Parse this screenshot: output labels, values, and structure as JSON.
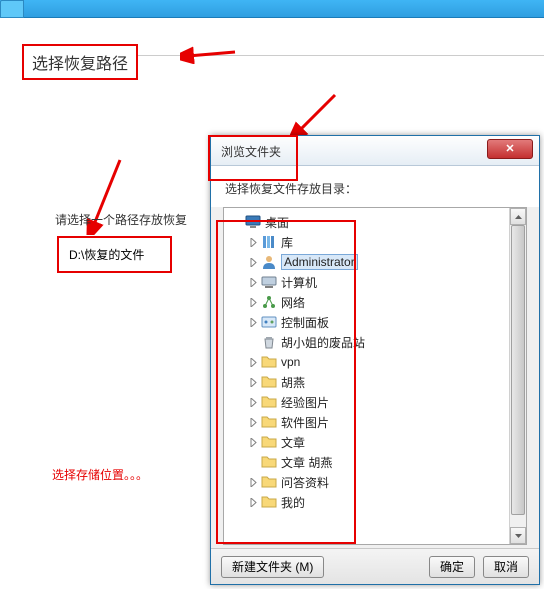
{
  "section_title": "选择恢复路径",
  "label_text": "请选择一个路径存放恢复",
  "path_value": "D:\\恢复的文件",
  "choose_text": "选择存储位置。。。",
  "dialog": {
    "title": "浏览文件夹",
    "close": "✕",
    "subtitle": "选择恢复文件存放目录：",
    "footer": {
      "new_folder": "新建文件夹 (M)",
      "ok": "确定",
      "cancel": "取消"
    }
  },
  "tree": [
    {
      "icon": "desktop",
      "label": "桌面",
      "depth": 0,
      "expand": "none"
    },
    {
      "icon": "library",
      "label": "库",
      "depth": 1,
      "expand": "closed"
    },
    {
      "icon": "user",
      "label": "Administrator",
      "depth": 1,
      "expand": "closed",
      "selected": true
    },
    {
      "icon": "computer",
      "label": "计算机",
      "depth": 1,
      "expand": "closed"
    },
    {
      "icon": "network",
      "label": "网络",
      "depth": 1,
      "expand": "closed"
    },
    {
      "icon": "control",
      "label": "控制面板",
      "depth": 1,
      "expand": "closed"
    },
    {
      "icon": "recycle",
      "label": "胡小姐的废品站",
      "depth": 1,
      "expand": "none"
    },
    {
      "icon": "folder",
      "label": "vpn",
      "depth": 1,
      "expand": "closed"
    },
    {
      "icon": "folder",
      "label": "胡燕",
      "depth": 1,
      "expand": "closed"
    },
    {
      "icon": "folder",
      "label": "经验图片",
      "depth": 1,
      "expand": "closed"
    },
    {
      "icon": "folder",
      "label": "软件图片",
      "depth": 1,
      "expand": "closed"
    },
    {
      "icon": "folder",
      "label": "文章",
      "depth": 1,
      "expand": "closed"
    },
    {
      "icon": "folder",
      "label": "文章  胡燕",
      "depth": 1,
      "expand": "none"
    },
    {
      "icon": "folder",
      "label": "问答资料",
      "depth": 1,
      "expand": "closed"
    },
    {
      "icon": "folder",
      "label": "我的",
      "depth": 1,
      "expand": "closed"
    }
  ]
}
